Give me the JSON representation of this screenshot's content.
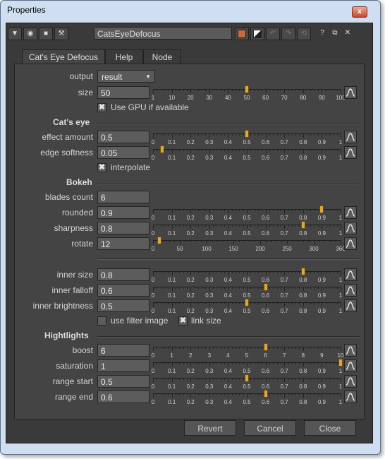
{
  "window": {
    "title": "Properties",
    "close_glyph": "x"
  },
  "toolbar": {
    "node_name": "CatsEyeDefocus",
    "icons": [
      "menu-triangle-icon",
      "viewer-icon",
      "camera-icon",
      "wrench-icon",
      "color-swatch-icon",
      "half-swatch-icon",
      "undo-icon",
      "redo-icon",
      "revert-icon",
      "help-icon",
      "float-icon",
      "close-icon"
    ],
    "help_glyph": "?",
    "float_glyph": "⧉",
    "close_glyph": "✕"
  },
  "tabs": [
    {
      "label": "Cat's Eye Defocus",
      "active": true
    },
    {
      "label": "Help",
      "active": false
    },
    {
      "label": "Node",
      "active": false
    }
  ],
  "controls": {
    "output": {
      "label": "output",
      "value": "result"
    },
    "size": {
      "label": "size",
      "value": "50",
      "level": 0.5
    },
    "use_gpu": {
      "label": "Use GPU if available",
      "checked": true
    },
    "effect_amount": {
      "label": "effect amount",
      "value": "0.5",
      "level": 0.5
    },
    "edge_softness": {
      "label": "edge softness",
      "value": "0.05",
      "level": 0.05
    },
    "interpolate": {
      "label": "interpolate",
      "checked": true
    },
    "blades_count": {
      "label": "blades count",
      "value": "6"
    },
    "rounded": {
      "label": "rounded",
      "value": "0.9",
      "level": 0.9
    },
    "sharpness": {
      "label": "sharpness",
      "value": "0.8",
      "level": 0.8
    },
    "rotate": {
      "label": "rotate",
      "value": "12",
      "level": 0.0333
    },
    "inner_size": {
      "label": "inner size",
      "value": "0.8",
      "level": 0.8
    },
    "inner_falloff": {
      "label": "inner falloff",
      "value": "0.6",
      "level": 0.6
    },
    "inner_brightness": {
      "label": "inner brightness",
      "value": "0.5",
      "level": 0.5
    },
    "use_filter_image": {
      "label": "use filter image",
      "checked": false
    },
    "link_size": {
      "label": "link size",
      "checked": true
    },
    "boost": {
      "label": "boost",
      "value": "6",
      "level": 0.6
    },
    "saturation": {
      "label": "saturation",
      "value": "1",
      "level": 1.0
    },
    "range_start": {
      "label": "range start",
      "value": "0.5",
      "level": 0.5
    },
    "range_end": {
      "label": "range end",
      "value": "0.6",
      "level": 0.6
    }
  },
  "sections": {
    "cats_eye": "Cat's eye",
    "bokeh": "Bokeh",
    "highlights": "Hightlights"
  },
  "scales": {
    "size": [
      "1",
      "10",
      "20",
      "30",
      "40",
      "50",
      "60",
      "70",
      "80",
      "90",
      "100"
    ],
    "unit": [
      "0",
      "0.1",
      "0.2",
      "0.3",
      "0.4",
      "0.5",
      "0.6",
      "0.7",
      "0.8",
      "0.9",
      "1"
    ],
    "rotate": [
      "0",
      "50",
      "100",
      "150",
      "200",
      "250",
      "300",
      "360"
    ],
    "boost": [
      "0",
      "1",
      "2",
      "3",
      "4",
      "5",
      "6",
      "7",
      "8",
      "9",
      "10"
    ]
  },
  "footer": {
    "revert": "Revert",
    "cancel": "Cancel",
    "close": "Close"
  }
}
